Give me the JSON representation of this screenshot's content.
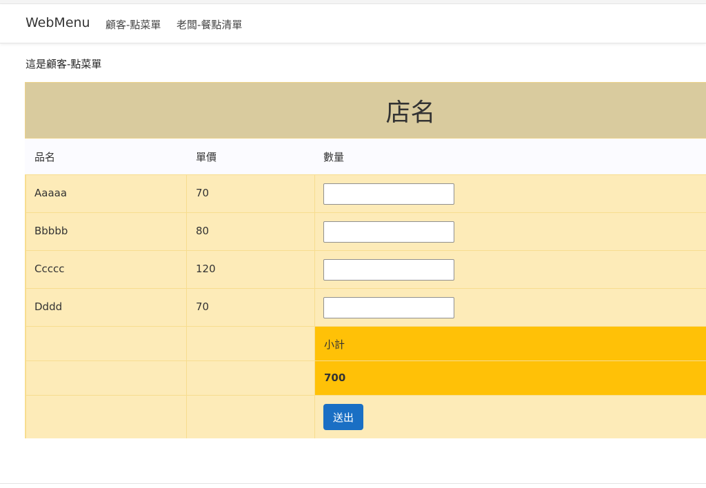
{
  "navbar": {
    "brand": "WebMenu",
    "links": [
      "顧客-點菜單",
      "老闆-餐點清單"
    ]
  },
  "page_note": "這是顧客-點菜單",
  "menu": {
    "shop_name": "店名",
    "columns": [
      "品名",
      "單價",
      "數量"
    ],
    "items": [
      {
        "name": "Aaaaa",
        "price": "70",
        "qty": ""
      },
      {
        "name": "Bbbbb",
        "price": "80",
        "qty": ""
      },
      {
        "name": "Ccccc",
        "price": "120",
        "qty": ""
      },
      {
        "name": "Dddd",
        "price": "70",
        "qty": ""
      }
    ],
    "subtotal_label": "小計",
    "subtotal_value": "700",
    "submit_label": "送出"
  },
  "colors": {
    "header_bg": "#d9cb9e",
    "row_bg": "#fdebb8",
    "subtotal_bg": "#ffc107",
    "button_bg": "#1a6fc4"
  }
}
